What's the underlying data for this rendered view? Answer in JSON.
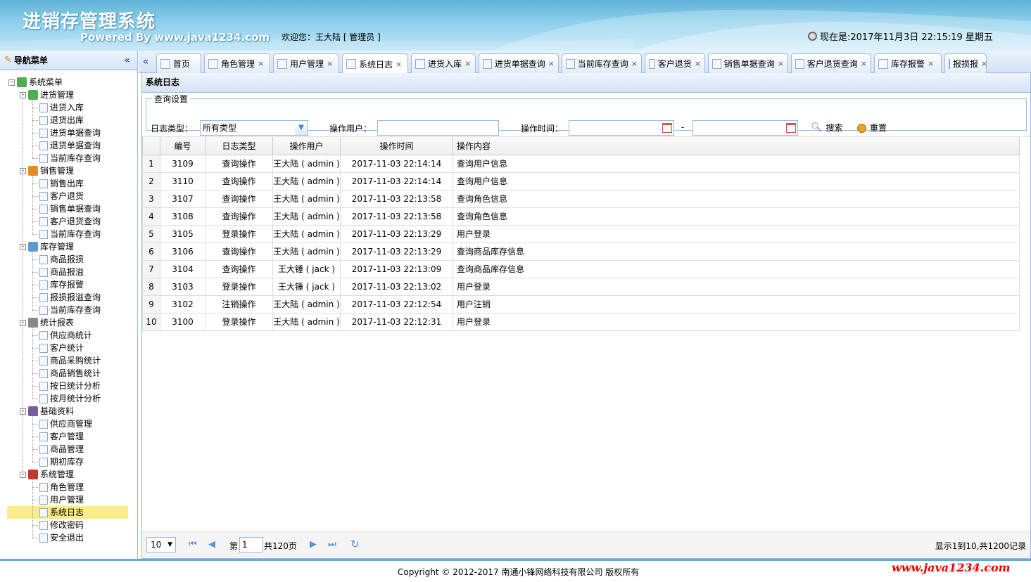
{
  "header": {
    "title": "进销存管理系统",
    "powered": "Powered By www.java1234.com",
    "welcome": "欢迎您：王大陆 [ 管理员 ]",
    "clock": "现在是:2017年11月3日 22:15:19 星期五"
  },
  "nav": {
    "title": "导航菜单",
    "root": "系统菜单",
    "groups": [
      {
        "label": "进货管理",
        "items": [
          "进货入库",
          "退货出库",
          "进货单据查询",
          "退货单据查询",
          "当前库存查询"
        ]
      },
      {
        "label": "销售管理",
        "items": [
          "销售出库",
          "客户退货",
          "销售单据查询",
          "客户退货查询",
          "当前库存查询"
        ]
      },
      {
        "label": "库存管理",
        "items": [
          "商品报损",
          "商品报溢",
          "库存报警",
          "报损报溢查询",
          "当前库存查询"
        ]
      },
      {
        "label": "统计报表",
        "items": [
          "供应商统计",
          "客户统计",
          "商品采购统计",
          "商品销售统计",
          "按日统计分析",
          "按月统计分析"
        ]
      },
      {
        "label": "基础资料",
        "items": [
          "供应商管理",
          "客户管理",
          "商品管理",
          "期初库存"
        ]
      },
      {
        "label": "系统管理",
        "items": [
          "角色管理",
          "用户管理",
          "系统日志",
          "修改密码",
          "安全退出"
        ]
      }
    ],
    "selected": "系统日志"
  },
  "tabs": [
    "首页",
    "角色管理",
    "用户管理",
    "系统日志",
    "进货入库",
    "进货单据查询",
    "当前库存查询",
    "客户退货",
    "销售单据查询",
    "客户退货查询",
    "库存报警",
    "报损报"
  ],
  "active_tab": "系统日志",
  "panel": {
    "title": "系统日志",
    "legend": "查询设置",
    "log_type_label": "日志类型：",
    "log_type_value": "所有类型",
    "user_label": "操作用户：",
    "time_label": "操作时间：",
    "dash": "-",
    "search_btn": "搜索",
    "reset_btn": "重置"
  },
  "table": {
    "columns": [
      "编号",
      "日志类型",
      "操作用户",
      "操作时间",
      "操作内容"
    ],
    "rows": [
      [
        "1",
        "3109",
        "查询操作",
        "王大陆 ( admin )",
        "2017-11-03 22:14:14",
        "查询用户信息"
      ],
      [
        "2",
        "3110",
        "查询操作",
        "王大陆 ( admin )",
        "2017-11-03 22:14:14",
        "查询用户信息"
      ],
      [
        "3",
        "3107",
        "查询操作",
        "王大陆 ( admin )",
        "2017-11-03 22:13:58",
        "查询角色信息"
      ],
      [
        "4",
        "3108",
        "查询操作",
        "王大陆 ( admin )",
        "2017-11-03 22:13:58",
        "查询角色信息"
      ],
      [
        "5",
        "3105",
        "登录操作",
        "王大陆 ( admin )",
        "2017-11-03 22:13:29",
        "用户登录"
      ],
      [
        "6",
        "3106",
        "查询操作",
        "王大陆 ( admin )",
        "2017-11-03 22:13:29",
        "查询商品库存信息"
      ],
      [
        "7",
        "3104",
        "查询操作",
        "王大锤 ( jack )",
        "2017-11-03 22:13:09",
        "查询商品库存信息"
      ],
      [
        "8",
        "3103",
        "登录操作",
        "王大锤 ( jack )",
        "2017-11-03 22:13:02",
        "用户登录"
      ],
      [
        "9",
        "3102",
        "注销操作",
        "王大陆 ( admin )",
        "2017-11-03 22:12:54",
        "用户注销"
      ],
      [
        "10",
        "3100",
        "登录操作",
        "王大陆 ( admin )",
        "2017-11-03 22:12:31",
        "用户登录"
      ]
    ]
  },
  "pager": {
    "page_size": "10",
    "page_prefix": "第",
    "page_value": "1",
    "page_suffix": "共120页",
    "info": "显示1到10,共1200记录"
  },
  "footer": {
    "copyright": "Copyright © 2012-2017 南通小锋网络科技有限公司 版权所有",
    "brand": "www.java1234.com"
  }
}
